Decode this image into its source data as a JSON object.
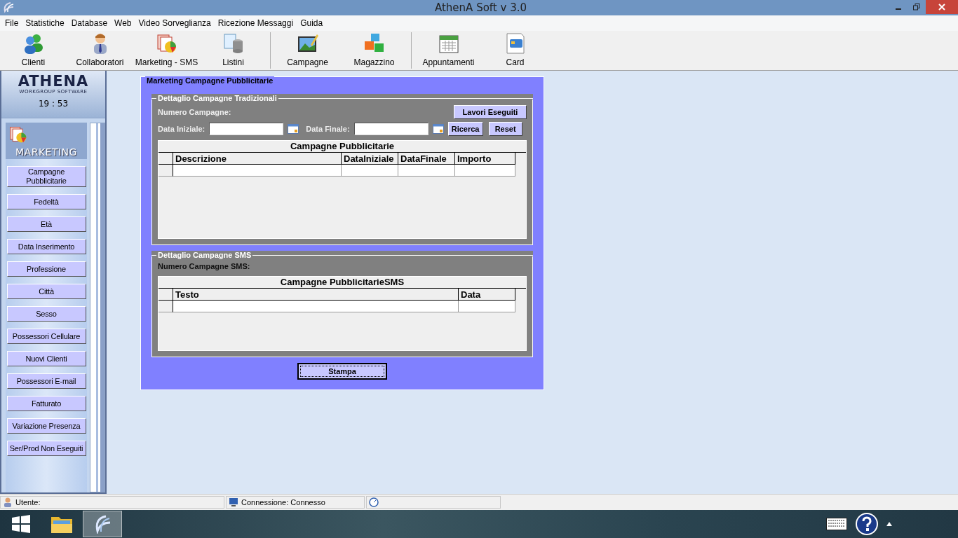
{
  "window": {
    "title": "AthenA Soft v 3.0"
  },
  "menu": [
    "File",
    "Statistiche",
    "Database",
    "Web",
    "Video Sorveglianza",
    "Ricezione Messaggi",
    "Guida"
  ],
  "toolbar": [
    [
      "Clienti",
      "Collaboratori",
      "Marketing - SMS",
      "Listini"
    ],
    [
      "Campagne",
      "Magazzino"
    ],
    [
      "Appuntamenti",
      "Card"
    ]
  ],
  "sidebar": {
    "logo": "ATHENA",
    "logo_subtitle": "WORKGROUP SOFTWARE",
    "clock": "19 : 53",
    "section": "MARKETING",
    "items": [
      "Campagne Pubblicitarie",
      "Fedeltà",
      "Età",
      "Data Inserimento",
      "Professione",
      "Città",
      "Sesso",
      "Possessori Cellulare",
      "Nuovi Clienti",
      "Possessori E-mail",
      "Fatturato",
      "Variazione Presenza",
      "Ser/Prod Non Eseguiti"
    ]
  },
  "panel": {
    "title": "Marketing Campagne Pubblicitarie",
    "traditional": {
      "title": "Dettaglio Campagne Tradizionali",
      "count_label": "Numero Campagne:",
      "lavori_button": "Lavori Eseguiti",
      "start_label": "Data Iniziale:",
      "end_label": "Data Finale:",
      "search_button": "Ricerca",
      "reset_button": "Reset",
      "table": {
        "title": "Campagne Pubblicitarie",
        "columns": [
          "Descrizione",
          "DataIniziale",
          "DataFinale",
          "Importo"
        ]
      }
    },
    "sms": {
      "title": "Dettaglio Campagne SMS",
      "count_label": "Numero Campagne SMS:",
      "table": {
        "title": "Campagne PubblicitarieSMS",
        "columns": [
          "Testo",
          "Data"
        ]
      }
    },
    "print_button": "Stampa"
  },
  "status_bar": {
    "user": "Utente:",
    "connection": "Connessione: Connesso"
  }
}
